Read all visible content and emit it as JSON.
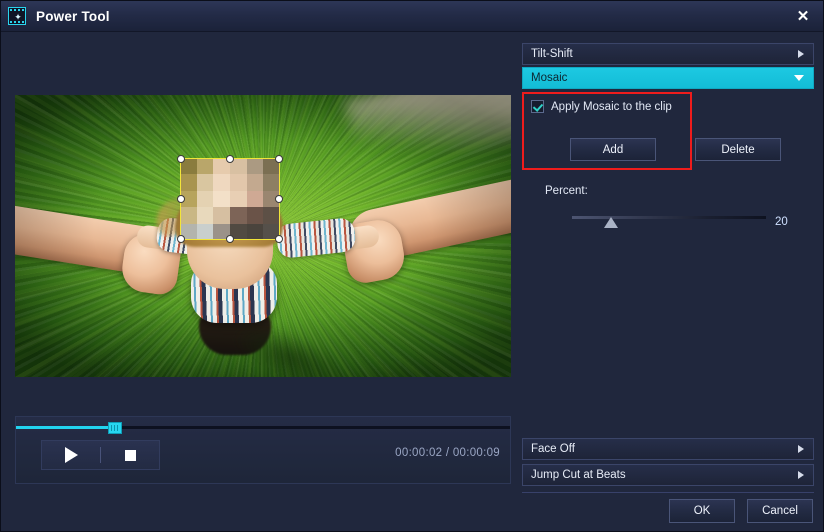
{
  "window": {
    "title": "Power Tool",
    "app_icon": "film-wand-icon",
    "close_label": "✕",
    "background_color": "#20273d",
    "accent_color": "#17c5dc",
    "highlight_color": "#ee1c1c"
  },
  "preview": {
    "selection": {
      "border_color": "#f2e53a",
      "handle_count": 8
    },
    "mosaic_tiles": [
      "#8a7c3e",
      "#b9a66a",
      "#e6cbad",
      "#d8c0a2",
      "#ab9a82",
      "#7b6f52",
      "#a8944f",
      "#d9c6a0",
      "#efd8bf",
      "#e2c7ab",
      "#c3a98f",
      "#8d7f63",
      "#b7a45d",
      "#e4d2b2",
      "#f3e0c8",
      "#e8cfb4",
      "#cfa994",
      "#9a8670",
      "#c9b784",
      "#e8d9bc",
      "#d6bfa1",
      "#7d6457",
      "#6a5348",
      "#5d5046",
      "#b3b4ad",
      "#c9cfcd",
      "#9b9289",
      "#514a42",
      "#4a443d",
      "#55504a"
    ]
  },
  "transport": {
    "play_label": "play-icon",
    "stop_label": "stop-icon",
    "timecode": "00:00:02 / 00:00:09",
    "current_time": "00:00:02",
    "total_time": "00:00:09",
    "progress_percent": 20
  },
  "right_panel": {
    "sections_top": [
      {
        "label": "Tilt-Shift",
        "state": "collapsed"
      }
    ],
    "selected_section": {
      "label": "Mosaic",
      "state": "expanded"
    },
    "mosaic": {
      "checkbox_label": "Apply Mosaic to the clip",
      "checkbox_checked": true,
      "add_label": "Add",
      "delete_label": "Delete",
      "percent_label": "Percent:",
      "percent_value": "20",
      "percent_number": 20,
      "percent_min": 0,
      "percent_max": 100
    },
    "sections_bottom": [
      {
        "label": "Face Off",
        "state": "collapsed"
      },
      {
        "label": "Jump Cut at Beats",
        "state": "collapsed"
      }
    ]
  },
  "footer": {
    "ok_label": "OK",
    "cancel_label": "Cancel"
  }
}
